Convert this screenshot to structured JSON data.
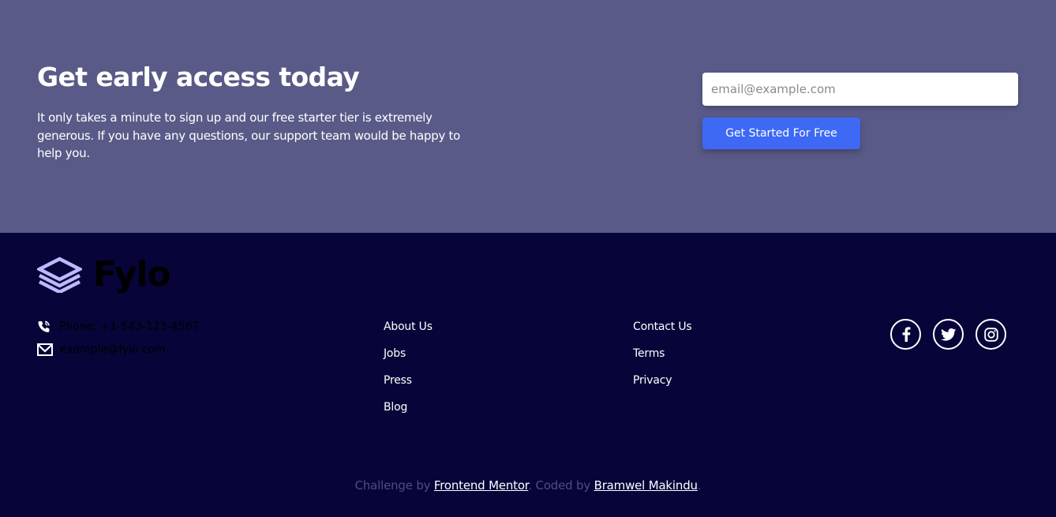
{
  "cta": {
    "title": "Get early access today",
    "text": "It only takes a minute to sign up and our free starter tier is extremely generous. If you have any questions, our support team would be happy to help you.",
    "email_placeholder": "email@example.com",
    "button_label": "Get Started For Free"
  },
  "footer": {
    "logo_text": "Fylo",
    "contact": {
      "phone": "Phone: +1-543-123-4567",
      "email": "example@fylo.com"
    },
    "links_col1": [
      "About Us",
      "Jobs",
      "Press",
      "Blog"
    ],
    "links_col2": [
      "Contact Us",
      "Terms",
      "Privacy"
    ],
    "social_icons": [
      "facebook-icon",
      "twitter-icon",
      "instagram-icon"
    ]
  },
  "attribution": {
    "prefix": "Challenge by ",
    "mentor_link": "Frontend Mentor",
    "middle": ". Coded by ",
    "author_link": "Bramwel Makindu",
    "suffix": "."
  },
  "colors": {
    "cta_bg": "#5a5a88",
    "footer_bg": "#070439",
    "accent": "#3d69f5",
    "logo_icon": "#c0b8ff",
    "muted_text": "#504d86"
  }
}
